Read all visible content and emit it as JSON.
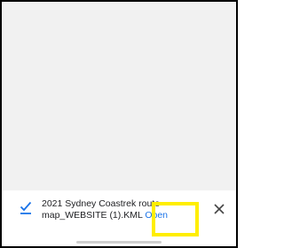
{
  "download": {
    "file_name": "2021 Sydney Coastrek route map_WEBSITE (1).KML",
    "open_label": "Open",
    "status_icon": "download-done-icon",
    "close_icon": "close-icon"
  },
  "colors": {
    "link": "#1a73e8",
    "highlight": "#ffee00",
    "content_background": "#f1f1f1"
  }
}
